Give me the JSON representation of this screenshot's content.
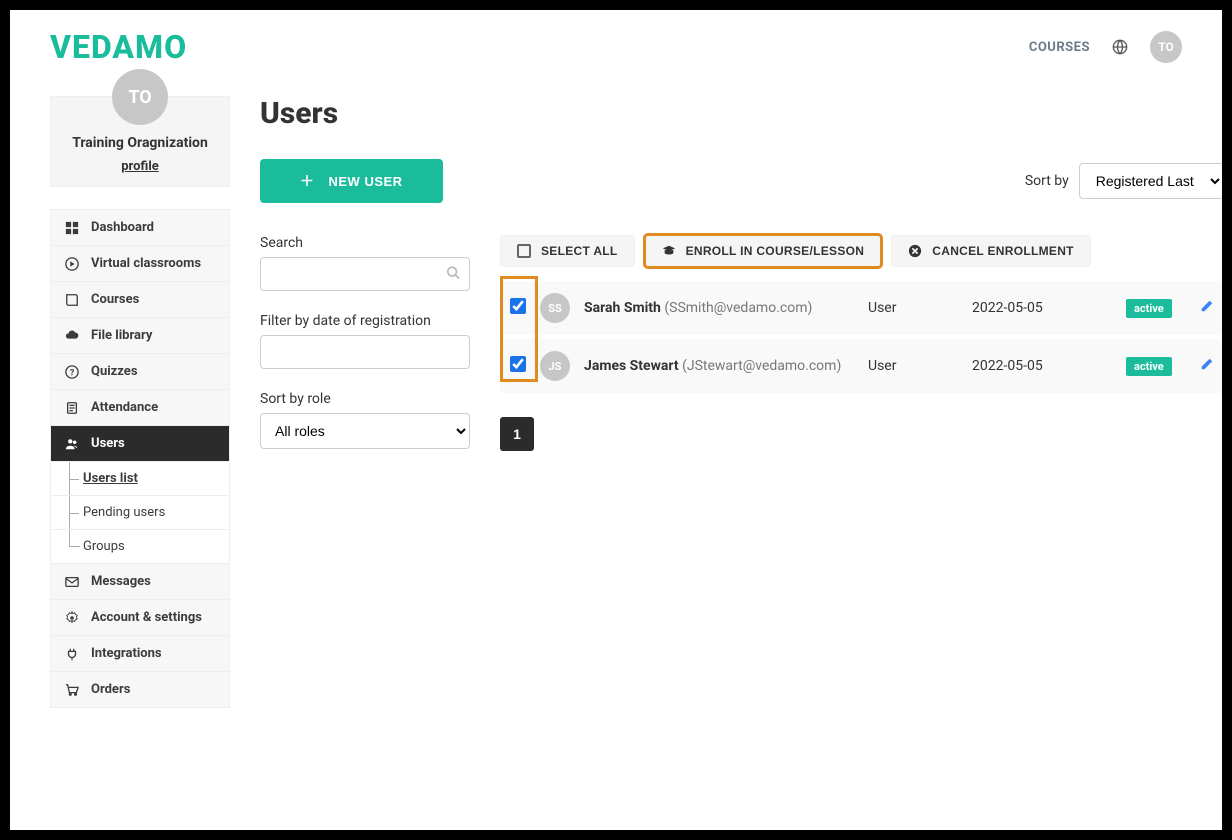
{
  "header": {
    "logo": "VEDAMO",
    "courses_link": "COURSES",
    "avatar_initials": "TO"
  },
  "org": {
    "avatar_initials": "TO",
    "name": "Training Oragnization",
    "profile_link": "profile"
  },
  "sidebar": {
    "items": [
      {
        "label": "Dashboard"
      },
      {
        "label": "Virtual classrooms"
      },
      {
        "label": "Courses"
      },
      {
        "label": "File library"
      },
      {
        "label": "Quizzes"
      },
      {
        "label": "Attendance"
      },
      {
        "label": "Users"
      },
      {
        "label": "Messages"
      },
      {
        "label": "Account & settings"
      },
      {
        "label": "Integrations"
      },
      {
        "label": "Orders"
      }
    ],
    "users_sub": [
      {
        "label": "Users list"
      },
      {
        "label": "Pending users"
      },
      {
        "label": "Groups"
      }
    ]
  },
  "page": {
    "title": "Users",
    "new_user_btn": "NEW USER",
    "sort_by_label": "Sort by",
    "sort_by_value": "Registered Last"
  },
  "filters": {
    "search_label": "Search",
    "search_placeholder": "",
    "date_label": "Filter by date of registration",
    "role_label": "Sort by role",
    "role_value": "All roles"
  },
  "actions": {
    "select_all": "SELECT ALL",
    "enroll": "ENROLL IN COURSE/LESSON",
    "cancel": "CANCEL ENROLLMENT"
  },
  "users": [
    {
      "initials": "SS",
      "name": "Sarah Smith",
      "email": "(SSmith@vedamo.com)",
      "role": "User",
      "date": "2022-05-05",
      "status": "active",
      "checked": true
    },
    {
      "initials": "JS",
      "name": "James Stewart",
      "email": "(JStewart@vedamo.com)",
      "role": "User",
      "date": "2022-05-05",
      "status": "active",
      "checked": true
    }
  ],
  "pagination": {
    "current": "1"
  }
}
